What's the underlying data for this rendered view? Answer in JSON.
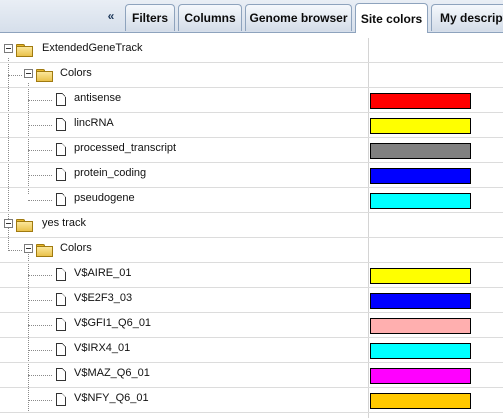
{
  "tabs": {
    "collapse_glyph": "«",
    "items": [
      {
        "label": "Filters"
      },
      {
        "label": "Columns"
      },
      {
        "label": "Genome browser"
      },
      {
        "label": "Site colors"
      },
      {
        "label": "My descript"
      }
    ],
    "active": "Site colors"
  },
  "tree": {
    "track1": {
      "label": "ExtendedGeneTrack",
      "colors_label": "Colors",
      "items": [
        {
          "label": "antisense",
          "color": "#ff0000"
        },
        {
          "label": "lincRNA",
          "color": "#ffff00"
        },
        {
          "label": "processed_transcript",
          "color": "#808080"
        },
        {
          "label": "protein_coding",
          "color": "#0000ff"
        },
        {
          "label": "pseudogene",
          "color": "#00ffff"
        }
      ]
    },
    "track2": {
      "label": "yes track",
      "colors_label": "Colors",
      "items": [
        {
          "label": "V$AIRE_01",
          "color": "#ffff00"
        },
        {
          "label": "V$E2F3_03",
          "color": "#0000ff"
        },
        {
          "label": "V$GFI1_Q6_01",
          "color": "#ffafaf"
        },
        {
          "label": "V$IRX4_01",
          "color": "#00ffff"
        },
        {
          "label": "V$MAZ_Q6_01",
          "color": "#ff00ff"
        },
        {
          "label": "V$NFY_Q6_01",
          "color": "#ffc800"
        }
      ]
    }
  }
}
